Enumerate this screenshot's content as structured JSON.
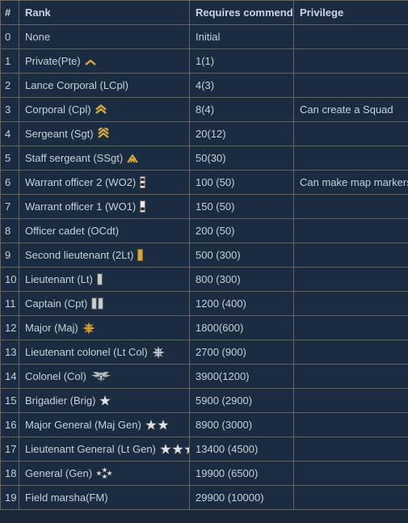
{
  "table": {
    "columns": [
      {
        "key": "num",
        "label": "#"
      },
      {
        "key": "rank",
        "label": "Rank"
      },
      {
        "key": "req",
        "label": "Requires commends"
      },
      {
        "key": "priv",
        "label": "Privilege"
      }
    ],
    "rows": [
      {
        "num": "0",
        "rank": "None",
        "insignia": "none",
        "req": "Initial",
        "priv": ""
      },
      {
        "num": "1",
        "rank": "Private(Pte)",
        "insignia": "gold-chevron-1",
        "req": "1(1)",
        "priv": ""
      },
      {
        "num": "2",
        "rank": "Lance Corporal (LCpl)",
        "insignia": "none",
        "req": "4(3)",
        "priv": ""
      },
      {
        "num": "3",
        "rank": "Corporal (Cpl)",
        "insignia": "gold-chevron-2",
        "req": "8(4)",
        "priv": "Can create a Squad"
      },
      {
        "num": "4",
        "rank": "Sergeant (Sgt)",
        "insignia": "gold-chevron-3",
        "req": "20(12)",
        "priv": ""
      },
      {
        "num": "5",
        "rank": "Staff sergeant (SSgt)",
        "insignia": "gold-chevron-rocker",
        "req": "50(30)",
        "priv": ""
      },
      {
        "num": "6",
        "rank": "Warrant officer 2 (WO2)",
        "insignia": "wo-bar-2",
        "req": "100 (50)",
        "priv": "Can make map markers"
      },
      {
        "num": "7",
        "rank": "Warrant officer 1 (WO1)",
        "insignia": "wo-bar-1",
        "req": "150 (50)",
        "priv": ""
      },
      {
        "num": "8",
        "rank": "Officer cadet (OCdt)",
        "insignia": "none",
        "req": "200 (50)",
        "priv": ""
      },
      {
        "num": "9",
        "rank": "Second lieutenant (2Lt)",
        "insignia": "gold-bar",
        "req": "500 (300)",
        "priv": ""
      },
      {
        "num": "10",
        "rank": "Lieutenant (Lt)",
        "insignia": "silver-bar",
        "req": "800 (300)",
        "priv": ""
      },
      {
        "num": "11",
        "rank": "Captain (Cpt)",
        "insignia": "silver-bar-double",
        "req": "1200 (400)",
        "priv": ""
      },
      {
        "num": "12",
        "rank": "Major (Maj)",
        "insignia": "gold-oak-leaf",
        "req": "1800(600)",
        "priv": ""
      },
      {
        "num": "13",
        "rank": "Lieutenant colonel (Lt Col)",
        "insignia": "silver-oak-leaf",
        "req": "2700 (900)",
        "priv": ""
      },
      {
        "num": "14",
        "rank": "Colonel (Col)",
        "insignia": "silver-eagle",
        "req": "3900(1200)",
        "priv": ""
      },
      {
        "num": "15",
        "rank": "Brigadier (Brig)",
        "insignia": "star-1",
        "req": "5900 (2900)",
        "priv": ""
      },
      {
        "num": "16",
        "rank": "Major General (Maj Gen)",
        "insignia": "star-2",
        "req": "8900 (3000)",
        "priv": ""
      },
      {
        "num": "17",
        "rank": "Lieutenant General (Lt Gen)",
        "insignia": "star-3",
        "req": "13400 (4500)",
        "priv": ""
      },
      {
        "num": "18",
        "rank": "General (Gen)",
        "insignia": "star-4-cluster",
        "req": "19900 (6500)",
        "priv": ""
      },
      {
        "num": "19",
        "rank": "Field marsha(FM)",
        "insignia": "none",
        "req": "29900 (10000)",
        "priv": ""
      }
    ]
  },
  "colors": {
    "page_background": "#1b2838",
    "cell_background": "#1c2c40",
    "border": "#66635a",
    "text": "#c3d0dd",
    "gold": "#d4a843",
    "silver": "#c9cdd2"
  }
}
